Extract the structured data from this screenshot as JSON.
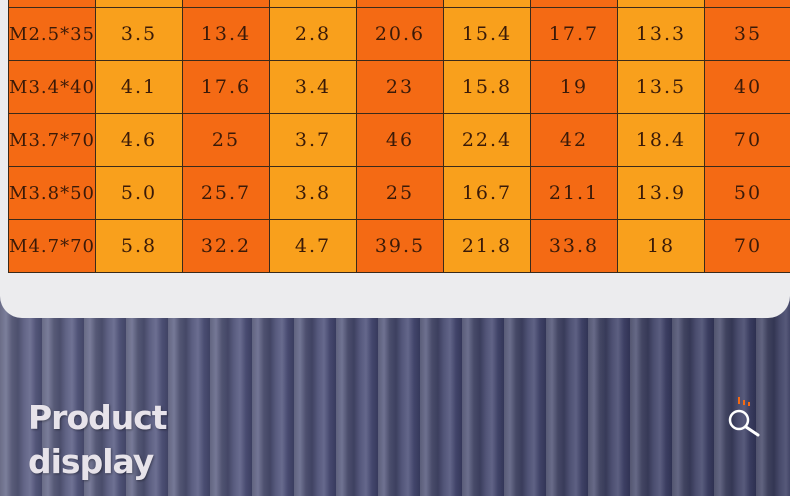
{
  "table": {
    "rows": [
      [
        "",
        "",
        "",
        "",
        "",
        "",
        "",
        "",
        ""
      ],
      [
        "M2.5*35",
        "3.5",
        "13.4",
        "2.8",
        "20.6",
        "15.4",
        "17.7",
        "13.3",
        "35"
      ],
      [
        "M3.4*40",
        "4.1",
        "17.6",
        "3.4",
        "23",
        "15.8",
        "19",
        "13.5",
        "40"
      ],
      [
        "M3.7*70",
        "4.6",
        "25",
        "3.7",
        "46",
        "22.4",
        "42",
        "18.4",
        "70"
      ],
      [
        "M3.8*50",
        "5.0",
        "25.7",
        "3.8",
        "25",
        "16.7",
        "21.1",
        "13.9",
        "50"
      ],
      [
        "M4.7*70",
        "5.8",
        "32.2",
        "4.7",
        "39.5",
        "21.8",
        "33.8",
        "18",
        "70"
      ]
    ]
  },
  "banner": {
    "title_line1": "Product",
    "title_line2": "display",
    "icon": "search-icon"
  },
  "colors": {
    "orange_dark": "#f46a14",
    "orange_light": "#f9a01c",
    "card_bg": "#ececee",
    "banner_bg": "#2c2f52",
    "icon_accent": "#f46a14"
  }
}
